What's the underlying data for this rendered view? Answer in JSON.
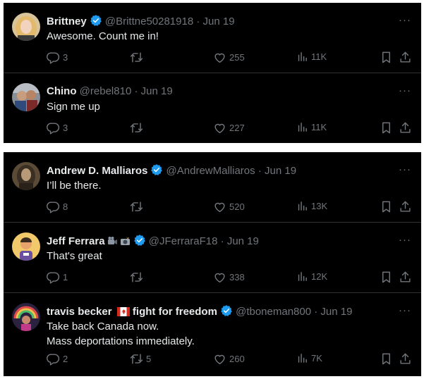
{
  "colors": {
    "background": "#000000",
    "text": "#e7e9ea",
    "muted": "#71767b",
    "verified": "#1d9bf0",
    "divider": "#2f3336"
  },
  "icons": {
    "reply": "reply-icon",
    "retweet": "retweet-icon",
    "like": "heart-icon",
    "views": "views-icon",
    "bookmark": "bookmark-icon",
    "share": "share-icon",
    "more": "more-icon",
    "verified": "verified-badge-icon"
  },
  "panel1": {
    "tweets": [
      {
        "name": "Brittney",
        "handle": "@Brittne50281918",
        "sep": "·",
        "date": "Jun 19",
        "text": "Awesome.  Count me in!",
        "more": "···",
        "replies": "3",
        "retweets": "",
        "likes": "255",
        "views": "11K"
      },
      {
        "name": "Chino",
        "handle": "@rebel810",
        "sep": "·",
        "date": "Jun 19",
        "text": "Sign me up",
        "more": "···",
        "replies": "3",
        "retweets": "",
        "likes": "227",
        "views": "11K"
      }
    ]
  },
  "panel2": {
    "tweets": [
      {
        "name": "Andrew D. Malliaros",
        "handle": "@AndrewMalliaros",
        "sep": "·",
        "date": "Jun 19",
        "text": "I’ll be there.",
        "more": "···",
        "replies": "8",
        "retweets": "",
        "likes": "520",
        "views": "13K"
      },
      {
        "name": "Jeff Ferrara",
        "handle": "@JFerraraF18",
        "sep": "·",
        "date": "Jun 19",
        "text": "That's great",
        "more": "···",
        "replies": "1",
        "retweets": "",
        "likes": "338",
        "views": "12K"
      },
      {
        "name": "travis becker",
        "name_suffix": "fight for freedom",
        "handle": "@tboneman800",
        "sep": "·",
        "date": "Jun 19",
        "text": "Take back Canada now.\nMass deportations immediately.",
        "more": "···",
        "replies": "2",
        "retweets": "5",
        "likes": "260",
        "views": "7K"
      }
    ]
  }
}
